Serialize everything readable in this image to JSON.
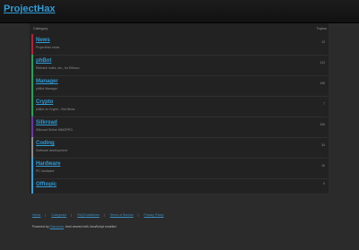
{
  "header": {
    "brand": "ProjectHax"
  },
  "table": {
    "category_header": "Category",
    "topics_header": "Topics"
  },
  "categories": [
    {
      "title": "News",
      "description": "ProjectHax news",
      "count": "13",
      "color": "#b3223a"
    },
    {
      "title": "phBot",
      "description": "Release notes, etc., for Ellimoo",
      "count": "113",
      "color": "#25a35a"
    },
    {
      "title": "Manager",
      "description": "phBot Manager",
      "count": "108",
      "color": "#25a35a"
    },
    {
      "title": "Crypto",
      "description": "phBot on Crypto - Bot News",
      "count": "7",
      "color": "#25a35a"
    },
    {
      "title": "Silkroad",
      "description": "Silkroad Online MMORPG",
      "count": "106",
      "color": "#6b3aa3"
    },
    {
      "title": "Coding",
      "description": "Software development",
      "count": "34",
      "color": "#8d8d8d"
    },
    {
      "title": "Hardware",
      "description": "PC hardware",
      "count": "16",
      "color": "#3a9fd8"
    },
    {
      "title": "Offtopic",
      "description": "",
      "count": "9",
      "color": "#3a9fd8"
    }
  ],
  "footer": {
    "links": [
      "Home",
      "Categories",
      "FAQ/Guidelines",
      "Terms of Service",
      "Privacy Policy"
    ],
    "credits_prefix": "Powered by",
    "credits_link": "Discourse",
    "credits_suffix": ", best viewed with JavaScript enabled"
  }
}
